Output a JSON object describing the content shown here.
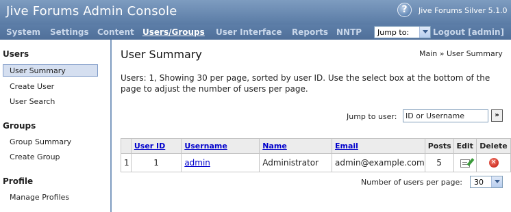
{
  "header": {
    "title": "Jive Forums Admin Console",
    "help_icon": "?",
    "version": "Jive Forums Silver 5.1.0"
  },
  "nav": {
    "items": [
      "System",
      "Settings",
      "Content",
      "Users/Groups",
      "User Interface",
      "Reports",
      "NNTP"
    ],
    "active": "Users/Groups",
    "jump_to": "Jump to:",
    "logout": "Logout [admin]"
  },
  "sidebar": {
    "sections": [
      {
        "heading": "Users",
        "items": [
          "User Summary",
          "Create User",
          "User Search"
        ]
      },
      {
        "heading": "Groups",
        "items": [
          "Group Summary",
          "Create Group"
        ]
      },
      {
        "heading": "Profile",
        "items": [
          "Manage Profiles"
        ]
      }
    ],
    "selected": "User Summary"
  },
  "main": {
    "title": "User Summary",
    "breadcrumb": {
      "root": "Main",
      "separator": "»",
      "current": "User Summary"
    },
    "description": "Users: 1, Showing 30 per page, sorted by user ID. Use the select box at the bottom of the page to adjust the number of users per page.",
    "jump_to_user": {
      "label": "Jump to user:",
      "value": "ID or Username",
      "go_label": "»"
    }
  },
  "table": {
    "columns": [
      "",
      "User ID",
      "Username",
      "Name",
      "Email",
      "Posts",
      "Edit",
      "Delete"
    ],
    "rows": [
      {
        "index": "1",
        "user_id": "1",
        "username": "admin",
        "name": "Administrator",
        "email": "admin@example.com",
        "posts": "5",
        "edit_icon": "edit-icon",
        "delete_icon": "delete-icon"
      }
    ]
  },
  "pagination": {
    "label": "Number of users per page:",
    "value": "30"
  },
  "colors": {
    "header": "#6a8ab3",
    "nav": "#5676a1",
    "accent": "#7e9cc0",
    "link": "#0000cc",
    "selected_bg": "#d5dff0"
  }
}
